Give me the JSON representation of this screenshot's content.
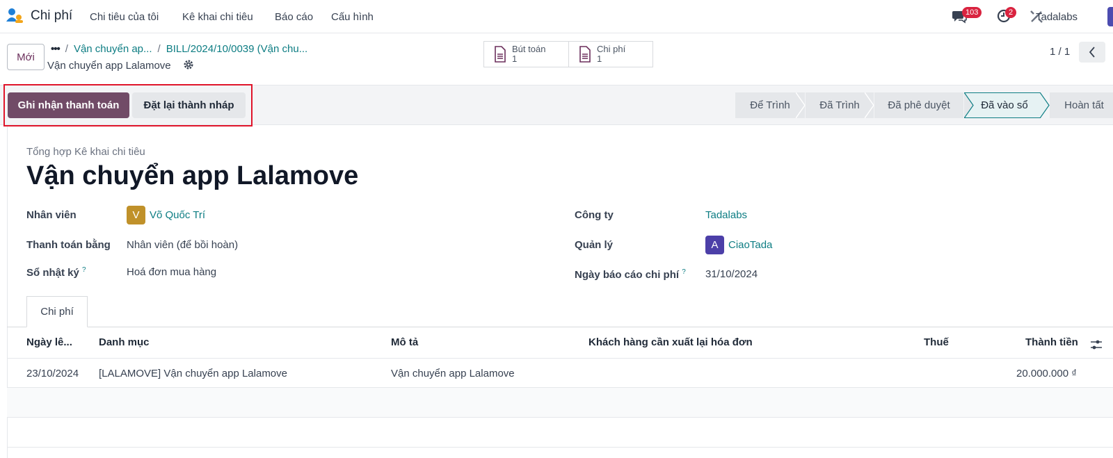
{
  "navbar": {
    "app_name": "Chi phí",
    "menu": [
      "Chi tiêu của tôi",
      "Kê khai chi tiêu",
      "Báo cáo",
      "Cấu hình"
    ],
    "messages_count": "103",
    "activities_count": "2",
    "company": "Tadalabs"
  },
  "control": {
    "new_label": "Mới",
    "breadcrumb_ellipsis": "•••",
    "breadcrumb_1": "Vận chuyển ap...",
    "breadcrumb_2": "BILL/2024/10/0039 (Vận chu...",
    "record_name": "Vận chuyển app Lalamove",
    "smart_buttons": [
      {
        "label": "Bút toán",
        "count": "1",
        "icon": "document-icon"
      },
      {
        "label": "Chi phí",
        "count": "1",
        "icon": "document-icon"
      }
    ],
    "pager": "1 / 1"
  },
  "actions": {
    "register_payment": "Ghi nhận thanh toán",
    "reset_to_draft": "Đặt lại thành nháp"
  },
  "stages": {
    "items": [
      "Để Trình",
      "Đã Trình",
      "Đã phê duyệt",
      "Đã vào sổ",
      "Hoàn tất"
    ],
    "active": "Đã vào sổ"
  },
  "form": {
    "subtitle": "Tổng hợp Kê khai chi tiêu",
    "title": "Vận chuyển app Lalamove",
    "employee_label": "Nhân viên",
    "employee_initial": "V",
    "employee": "Võ Quốc Trí",
    "paid_by_label": "Thanh toán bằng",
    "paid_by": "Nhân viên (để bồi hoàn)",
    "journal_label": "Sổ nhật ký",
    "journal": "Hoá đơn mua hàng",
    "company_label": "Công ty",
    "company": "Tadalabs",
    "manager_label": "Quản lý",
    "manager_initial": "A",
    "manager": "CiaoTada",
    "report_date_label": "Ngày báo cáo chi phí",
    "report_date": "31/10/2024",
    "help_mark": "?"
  },
  "tab": {
    "label": "Chi phí"
  },
  "table": {
    "headers": [
      "Ngày lê...",
      "Danh mục",
      "Mô tả",
      "Khách hàng cần xuất lại hóa đơn",
      "Thuế",
      "Thành tiền"
    ],
    "rows": [
      {
        "date": "23/10/2024",
        "category": "[LALAMOVE] Vận chuyển app Lalamove",
        "description": "Vận chuyển app Lalamove",
        "customer": "",
        "tax": "",
        "total": "20.000.000 ₫"
      }
    ]
  },
  "colors": {
    "primary": "#714b67",
    "link": "#0d7d83",
    "highlight": "#e0142a",
    "employee_avatar": "#c0912a",
    "manager_avatar": "#4c3fa8"
  }
}
